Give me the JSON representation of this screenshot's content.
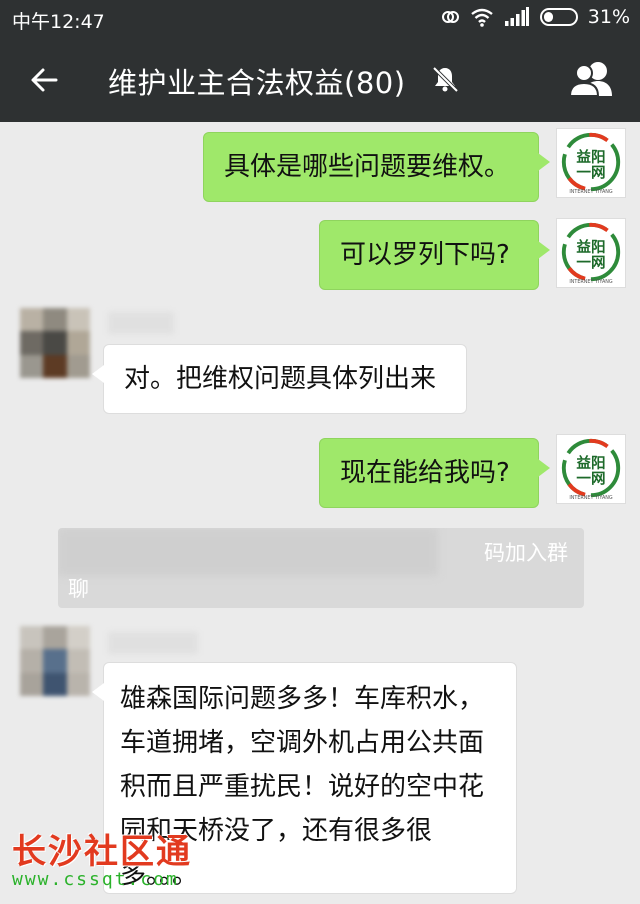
{
  "status_bar": {
    "time": "中午12:47",
    "battery_text": "31%",
    "battery_level": 0.31
  },
  "header": {
    "back_icon": "back-arrow-icon",
    "title": "维护业主合法权益(80)",
    "mute_icon": "muted-bell-icon",
    "group_icon": "group-members-icon"
  },
  "brand_avatar": {
    "line1": "益阳",
    "line2": "一网",
    "tagline": "INTERNET YIYANG"
  },
  "messages": [
    {
      "direction": "out",
      "text": "具体是哪些问题要维权。"
    },
    {
      "direction": "out",
      "text": "可以罗列下吗?"
    },
    {
      "direction": "in",
      "text": "对。把维权问题具体列出来"
    },
    {
      "direction": "out",
      "text": "现在能给我吗?"
    },
    {
      "direction": "in",
      "text": "雄森国际问题多多！车库积水，车道拥堵，空调外机占用公共面积而且严重扰民！说好的空中花园和天桥没了，还有很多很多。。。"
    }
  ],
  "system_notice": {
    "visible_text_end": "码加入群",
    "visible_text_line2": "聊"
  },
  "watermark": {
    "title": "长沙社区通",
    "url": "www.cssqt.com"
  },
  "colors": {
    "header_bg": "#2e3132",
    "chat_bg": "#ebebeb",
    "bubble_out": "#9fe86a",
    "bubble_in": "#ffffff",
    "watermark_red": "#e23a1f",
    "watermark_green": "#2bb22b"
  }
}
